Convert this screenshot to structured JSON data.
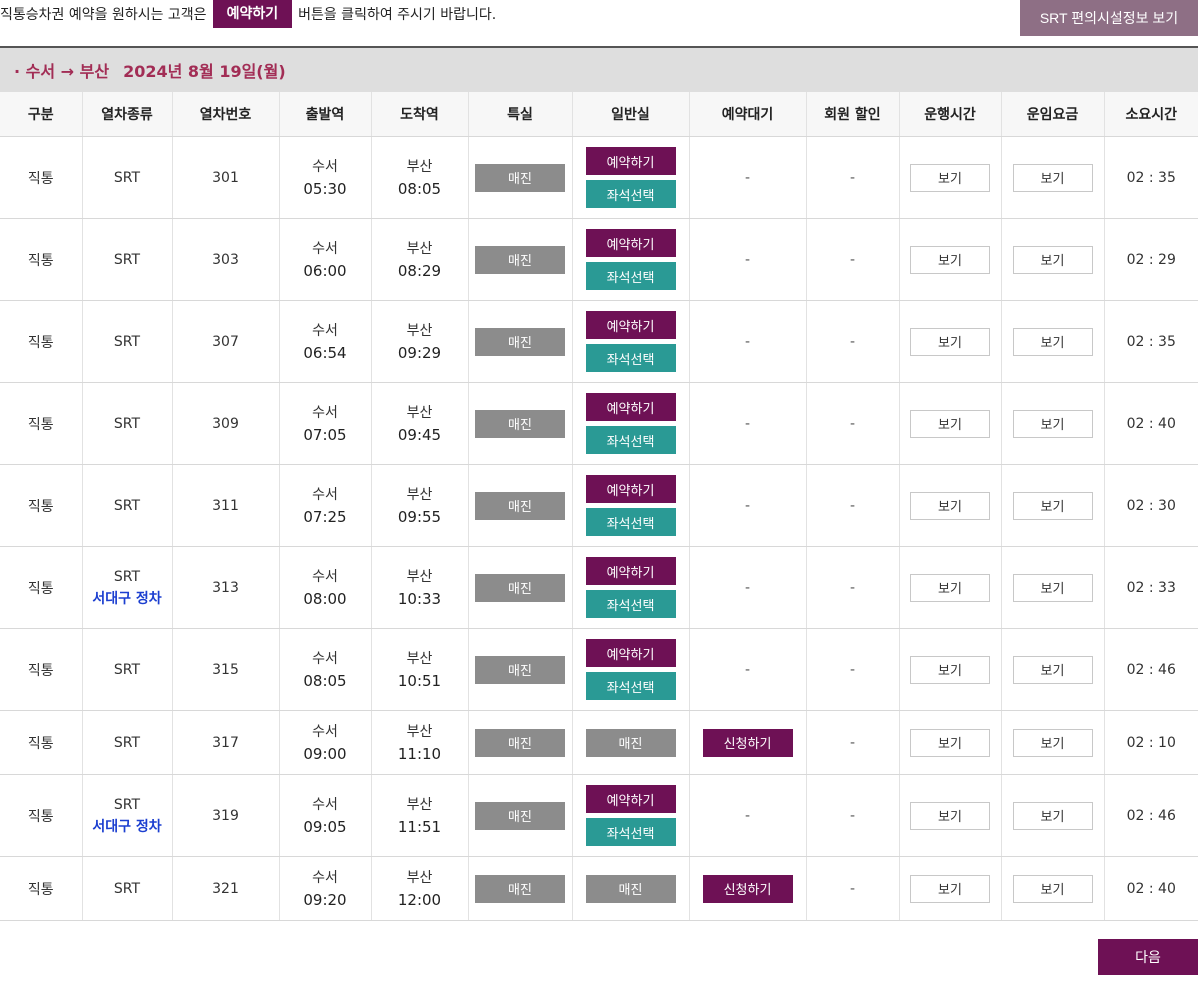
{
  "notice": {
    "before": "직통승차권 예약을 원하시는 고객은",
    "badge": "예약하기",
    "after": "버튼을 클릭하여 주시기 바랍니다."
  },
  "facility_button": "SRT 편의시설정보 보기",
  "route": {
    "label": "· 수서 → 부산",
    "date": "2024년 8월 19일(월)"
  },
  "columns": [
    "구분",
    "열차종류",
    "열차번호",
    "출발역",
    "도착역",
    "특실",
    "일반실",
    "예약대기",
    "회원 할인",
    "운행시간",
    "운임요금",
    "소요시간"
  ],
  "labels": {
    "soldout": "매진",
    "reserve": "예약하기",
    "seat": "좌석선택",
    "wait": "신청하기",
    "view": "보기",
    "dash": "-"
  },
  "trains": [
    {
      "category": "직통",
      "type": "SRT",
      "note": "",
      "number": "301",
      "dep_station": "수서",
      "dep_time": "05:30",
      "arr_station": "부산",
      "arr_time": "08:05",
      "general": "available",
      "waitlist": "-",
      "discount": "-",
      "duration": "02 : 35"
    },
    {
      "category": "직통",
      "type": "SRT",
      "note": "",
      "number": "303",
      "dep_station": "수서",
      "dep_time": "06:00",
      "arr_station": "부산",
      "arr_time": "08:29",
      "general": "available",
      "waitlist": "-",
      "discount": "-",
      "duration": "02 : 29"
    },
    {
      "category": "직통",
      "type": "SRT",
      "note": "",
      "number": "307",
      "dep_station": "수서",
      "dep_time": "06:54",
      "arr_station": "부산",
      "arr_time": "09:29",
      "general": "available",
      "waitlist": "-",
      "discount": "-",
      "duration": "02 : 35"
    },
    {
      "category": "직통",
      "type": "SRT",
      "note": "",
      "number": "309",
      "dep_station": "수서",
      "dep_time": "07:05",
      "arr_station": "부산",
      "arr_time": "09:45",
      "general": "available",
      "waitlist": "-",
      "discount": "-",
      "duration": "02 : 40"
    },
    {
      "category": "직통",
      "type": "SRT",
      "note": "",
      "number": "311",
      "dep_station": "수서",
      "dep_time": "07:25",
      "arr_station": "부산",
      "arr_time": "09:55",
      "general": "available",
      "waitlist": "-",
      "discount": "-",
      "duration": "02 : 30"
    },
    {
      "category": "직통",
      "type": "SRT",
      "note": "서대구 정차",
      "number": "313",
      "dep_station": "수서",
      "dep_time": "08:00",
      "arr_station": "부산",
      "arr_time": "10:33",
      "general": "available",
      "waitlist": "-",
      "discount": "-",
      "duration": "02 : 33"
    },
    {
      "category": "직통",
      "type": "SRT",
      "note": "",
      "number": "315",
      "dep_station": "수서",
      "dep_time": "08:05",
      "arr_station": "부산",
      "arr_time": "10:51",
      "general": "available",
      "waitlist": "-",
      "discount": "-",
      "duration": "02 : 46"
    },
    {
      "category": "직통",
      "type": "SRT",
      "note": "",
      "number": "317",
      "dep_station": "수서",
      "dep_time": "09:00",
      "arr_station": "부산",
      "arr_time": "11:10",
      "general": "soldout",
      "waitlist": "apply",
      "discount": "-",
      "duration": "02 : 10"
    },
    {
      "category": "직통",
      "type": "SRT",
      "note": "서대구 정차",
      "number": "319",
      "dep_station": "수서",
      "dep_time": "09:05",
      "arr_station": "부산",
      "arr_time": "11:51",
      "general": "available",
      "waitlist": "-",
      "discount": "-",
      "duration": "02 : 46"
    },
    {
      "category": "직통",
      "type": "SRT",
      "note": "",
      "number": "321",
      "dep_station": "수서",
      "dep_time": "09:20",
      "arr_station": "부산",
      "arr_time": "12:00",
      "general": "soldout",
      "waitlist": "apply",
      "discount": "-",
      "duration": "02 : 40"
    }
  ],
  "next_button": "다음",
  "colors": {
    "accent": "#6e1155",
    "seat": "#2a9a95",
    "soldout": "#8c8c8c",
    "route_text": "#a22d55",
    "stop_note": "#1c3fd0"
  }
}
